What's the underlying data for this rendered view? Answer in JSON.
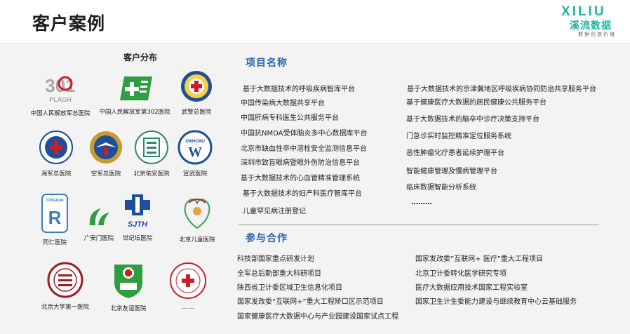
{
  "page": {
    "title": "客户案例"
  },
  "logo": {
    "latin": "XILIU",
    "chinese": "溪流数据",
    "slogan": "数据创造价值"
  },
  "distribution": {
    "title": "客户分布",
    "hospitals": [
      {
        "label": "中国人民解放军总医院",
        "logo_text": "301",
        "logo_sub": "PLAGH"
      },
      {
        "label": "中国人民解放军第302医院"
      },
      {
        "label": "武警总医院"
      },
      {
        "label": "海军总医院"
      },
      {
        "label": "空军总医院"
      },
      {
        "label": "北京佑安医院"
      },
      {
        "label": "宣武医院",
        "logo_text": "XWHCMU"
      },
      {
        "label": "同仁医院",
        "logo_text": "TONGREN"
      },
      {
        "label": "广安门医院"
      },
      {
        "label": "世纪坛医院",
        "logo_text": "SJTH"
      },
      {
        "label": "北京儿童医院"
      },
      {
        "label": "北京大学第一医院"
      },
      {
        "label": "北京友谊医院"
      },
      {
        "label": "……"
      }
    ]
  },
  "projects": {
    "title": "项目名称",
    "left": [
      "基于大数据技术的呼吸疾病智库平台",
      "中国传染病大数据共享平台",
      "中国肝病专科医生公共服务平台",
      "中国抗NMDA受体脑炎多中心数据库平台",
      "北京市缺血性卒中溶栓安全监测信息平台",
      "深圳市致盲眼病暨眼外伤防治信息平台",
      "基于大数据技术的心血管精准管理系统",
      "基于大数据技术的妇产科医疗智库平台",
      "儿童罕见病注册登记"
    ],
    "right": [
      "基于大数据技术的京津冀地区呼吸疾病协同防治共享服务平台",
      "基于健康医疗大数据的居民健康公共服务平台",
      "基于大数据技术的脑卒中诊疗决策支持平台",
      "门急诊实时监控精准定位服务系统",
      "恶性肿瘤化疗患者延续护理平台",
      "智能健康管理及慢病管理平台",
      "临床数据智能分析系统",
      "………"
    ]
  },
  "cooperation": {
    "title": "参与合作",
    "left": [
      "科技部国家重点研发计划",
      "全军总后勤部重大科研项目",
      "陕西省卫计委区域卫生信息化项目",
      "国家发改委“互联网+”重大工程矫口区示范项目",
      "国家健康医疗大数据中心与产业园建设国家试点工程"
    ],
    "right": [
      "国家发改委”互联网+ 医疗”重大工程项目",
      "北京卫计委转化医学研究专项",
      "医疗大数据应用技术国家工程实验室",
      "国家卫生计生委能力建设与继续教育中心云基础服务"
    ]
  },
  "colors": {
    "accent": "#2a64a6",
    "brand": "#1fb3a4",
    "medical_red": "#c8202a",
    "medical_green": "#2e9e3e"
  }
}
